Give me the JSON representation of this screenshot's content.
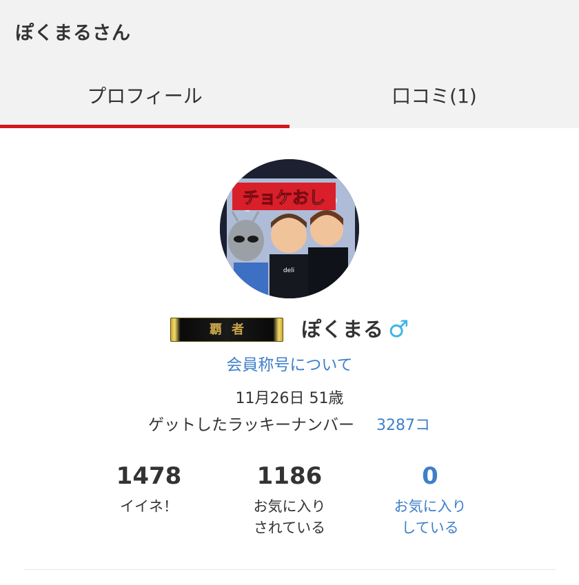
{
  "header": {
    "title": "ぽくまるさん"
  },
  "tabs": [
    {
      "label": "プロフィール",
      "active": true
    },
    {
      "label": "口コミ(1)",
      "active": false
    }
  ],
  "profile": {
    "avatar_text": "チョケおし",
    "title_badge": "覇者",
    "username": "ぽくまる",
    "gender_icon": "male-symbol-icon",
    "gender_symbol": "♂",
    "title_link": "会員称号について",
    "birth_age": "11月26日 51歳",
    "lucky_label": "ゲットしたラッキーナンバー",
    "lucky_count": "3287コ"
  },
  "stats": [
    {
      "value": "1478",
      "label_line1": "イイネ！",
      "label_line2": ""
    },
    {
      "value": "1186",
      "label_line1": "お気に入り",
      "label_line2": "されている"
    },
    {
      "value": "0",
      "label_line1": "お気に入り",
      "label_line2": "している"
    }
  ],
  "colors": {
    "accent_red": "#d4151c",
    "link_blue": "#3e7fc9",
    "gender_blue": "#3ab6e6"
  }
}
